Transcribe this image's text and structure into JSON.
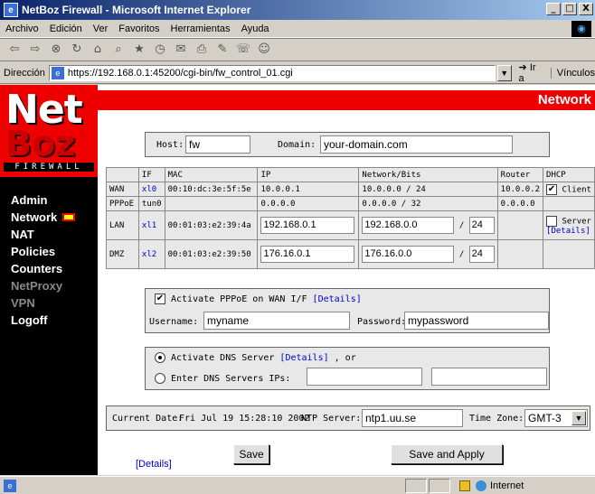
{
  "window": {
    "title": "NetBoz Firewall - Microsoft Internet Explorer",
    "btn_minimize": "_",
    "btn_maximize": "□",
    "btn_close": "X"
  },
  "menu": [
    "Archivo",
    "Edición",
    "Ver",
    "Favoritos",
    "Herramientas",
    "Ayuda"
  ],
  "toolbar_icons": [
    "back-icon",
    "forward-icon",
    "stop-icon",
    "refresh-icon",
    "home-icon",
    "search-icon",
    "favorites-icon",
    "history-icon",
    "mail-icon",
    "print-icon",
    "edit-icon",
    "discuss-icon",
    "messenger-icon"
  ],
  "address": {
    "label": "Dirección",
    "url": "https://192.168.0.1:45200/cgi-bin/fw_control_01.cgi",
    "go": "Ir a",
    "links": "Vínculos"
  },
  "logo": {
    "line1": "Net",
    "line2": "Boz",
    "line3": "FIREWALL"
  },
  "page_title": "Network",
  "nav": [
    {
      "label": "Admin",
      "active": false,
      "enabled": true
    },
    {
      "label": "Network",
      "active": true,
      "enabled": true
    },
    {
      "label": "NAT",
      "active": false,
      "enabled": true
    },
    {
      "label": "Policies",
      "active": false,
      "enabled": true
    },
    {
      "label": "Counters",
      "active": false,
      "enabled": true
    },
    {
      "label": "NetProxy",
      "active": false,
      "enabled": false
    },
    {
      "label": "VPN",
      "active": false,
      "enabled": false
    },
    {
      "label": "Logoff",
      "active": false,
      "enabled": true
    }
  ],
  "host": {
    "label": "Host:",
    "value": "fw"
  },
  "domain": {
    "label": "Domain:",
    "value": "your-domain.com"
  },
  "iftable": {
    "headers": [
      "IF",
      "MAC",
      "IP",
      "Network/Bits",
      "Router",
      "DHCP"
    ],
    "rows": [
      {
        "name": "WAN",
        "if": "xl0",
        "mac": "00:10:dc:3e:5f:5e",
        "ip": "10.0.0.1",
        "network": "10.0.0.0 / 24",
        "router": "10.0.0.2",
        "dhcp": "Client"
      },
      {
        "name": "PPPoE",
        "if": "tun0",
        "mac": "",
        "ip": "0.0.0.0",
        "network": "0.0.0.0 / 32",
        "router": "0.0.0.0",
        "dhcp": ""
      },
      {
        "name": "LAN",
        "if": "xl1",
        "mac": "00:01:03:e2:39:4a",
        "ip": "192.168.0.1",
        "network": "192.168.0.0",
        "bits": "24",
        "router": "",
        "dhcp": "Server",
        "dhcp_details": "[Details]"
      },
      {
        "name": "DMZ",
        "if": "xl2",
        "mac": "00:01:03:e2:39:50",
        "ip": "176.16.0.1",
        "network": "176.16.0.0",
        "bits": "24",
        "router": "",
        "dhcp": ""
      }
    ],
    "slash": "/"
  },
  "pppoe": {
    "activate_label": "Activate PPPoE on WAN I/F",
    "details": "[Details]",
    "username_label": "Username:",
    "username": "myname",
    "password_label": "Password:",
    "password": "mypassword"
  },
  "dns": {
    "activate_label": "Activate DNS Server",
    "details": "[Details]",
    "or_text": ", or",
    "enter_label": "Enter DNS Servers IPs:"
  },
  "time": {
    "date_label": "Current Date:",
    "date": "Fri Jul 19 15:28:10 2002",
    "ntp_label": "NTP Server:",
    "ntp": "ntp1.uu.se",
    "tz_label": "Time Zone:",
    "tz": "GMT-3"
  },
  "footer": {
    "details": "[Details]",
    "save": "Save",
    "save_apply": "Save and Apply"
  },
  "status": {
    "zone": "Internet"
  }
}
